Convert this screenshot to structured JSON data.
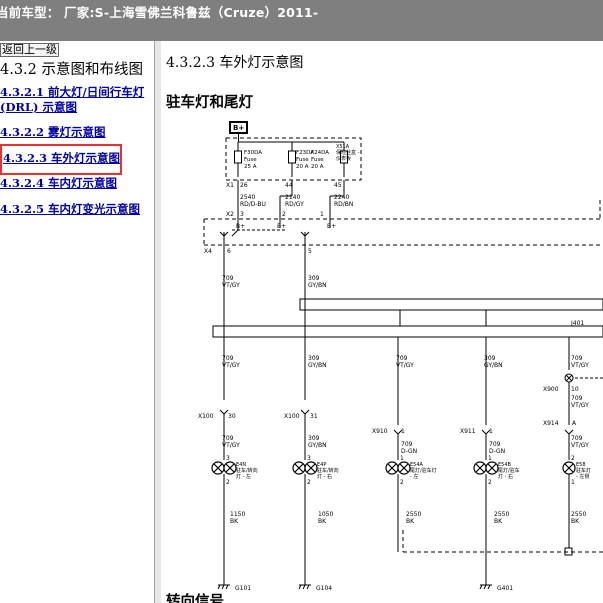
{
  "header": {
    "title": "当前车型： 厂家:S-上海雪佛兰科鲁兹（Cruze）2011-"
  },
  "sidebar": {
    "back_label": "返回上一级",
    "section_title": "4.3.2 示意图和布线图",
    "links": [
      {
        "label": "4.3.2.1 前大灯/日间行车灯",
        "label2": "(DRL) 示意图"
      },
      {
        "label": "4.3.2.2 雾灯示意图"
      },
      {
        "label": "4.3.2.3 车外灯示意图"
      },
      {
        "label": "4.3.2.4 车内灯示意图"
      },
      {
        "label": "4.3.2.5 车内灯变光示意图"
      }
    ]
  },
  "content": {
    "title": "4.3.2.3 车外灯示意图",
    "subheading": "驻车灯和尾灯",
    "next_heading": "转向信号"
  },
  "diagram": {
    "top_label": "B+",
    "fusebox_label1": "X51A",
    "fusebox_label2": "保险丝盒 -",
    "fusebox_label3": "仪表板",
    "fuses": [
      {
        "name": "F30DA",
        "kind": "Fuse",
        "amp": "25 A"
      },
      {
        "name": "F23DA",
        "kind": "Fuse",
        "amp": "20 A"
      },
      {
        "name": "F24DA",
        "kind": "Fuse",
        "amp": "20 A"
      }
    ],
    "x1": "X1",
    "pins_top": [
      "26",
      "44",
      "45"
    ],
    "wires_top": [
      {
        "num": "2540",
        "color": "RD/D-BU"
      },
      {
        "num": "2140",
        "color": "RD/GY"
      },
      {
        "num": "2240",
        "color": "RD/BN"
      }
    ],
    "x2": "X2",
    "x2_pins": [
      "3",
      "2",
      "1"
    ],
    "bplus": [
      "B+",
      "B+",
      "B+"
    ],
    "x4": "X4",
    "x4_pins": [
      "6",
      "5"
    ],
    "mid_wires": [
      {
        "num": "709",
        "color": "VT/GY"
      },
      {
        "num": "309",
        "color": "GY/BN"
      }
    ],
    "j401": "J401",
    "branch_wires": [
      {
        "num": "709",
        "color": "VT/GY"
      },
      {
        "num": "309",
        "color": "GY/BN"
      },
      {
        "num": "709",
        "color": "VT/GY"
      },
      {
        "num": "309",
        "color": "GY/BN"
      },
      {
        "num": "709",
        "color": "VT/GY"
      }
    ],
    "x900": "X900",
    "x900_pin": "10",
    "x100a": "X100",
    "x100a_pin": "30",
    "x100b": "X100",
    "x100b_pin": "31",
    "x910": "X910",
    "x910_pin": "1",
    "x911": "X911",
    "x911_pin": "1",
    "x914": "X914",
    "x914_pin": "A",
    "lamp_wires": [
      {
        "num": "709",
        "color": "VT/GY"
      },
      {
        "num": "309",
        "color": "GY/BN"
      },
      {
        "num": "709",
        "color": "D-GN"
      },
      {
        "num": "709",
        "color": "D-GN"
      },
      {
        "num": "709",
        "color": "VT/GY"
      }
    ],
    "lamps": [
      {
        "id": "E4N",
        "desc1": "驻车/转向",
        "desc2": "灯 - 左"
      },
      {
        "id": "E4P",
        "desc1": "驻车/转向",
        "desc2": "灯 - 右"
      },
      {
        "id": "E54A",
        "desc1": "尾灯/驻车灯",
        "desc2": "- 左"
      },
      {
        "id": "E54B",
        "desc1": "尾灯/驻车",
        "desc2": "灯 - 右"
      },
      {
        "id": "E58",
        "desc1": "驻车灯",
        "desc2": "- 左侧"
      }
    ],
    "lamp_pins_top": [
      "3",
      "3",
      "1",
      "1",
      "2"
    ],
    "lamp_pins_bottom": [
      "2",
      "2",
      "2",
      "2",
      "1"
    ],
    "ground_wires": [
      {
        "num": "1150",
        "color": "BK"
      },
      {
        "num": "1050",
        "color": "BK"
      },
      {
        "num": "2550",
        "color": "BK"
      },
      {
        "num": "2550",
        "color": "BK"
      },
      {
        "num": "2550",
        "color": "BK"
      }
    ],
    "grounds": [
      "G101",
      "G104",
      "G401"
    ]
  }
}
